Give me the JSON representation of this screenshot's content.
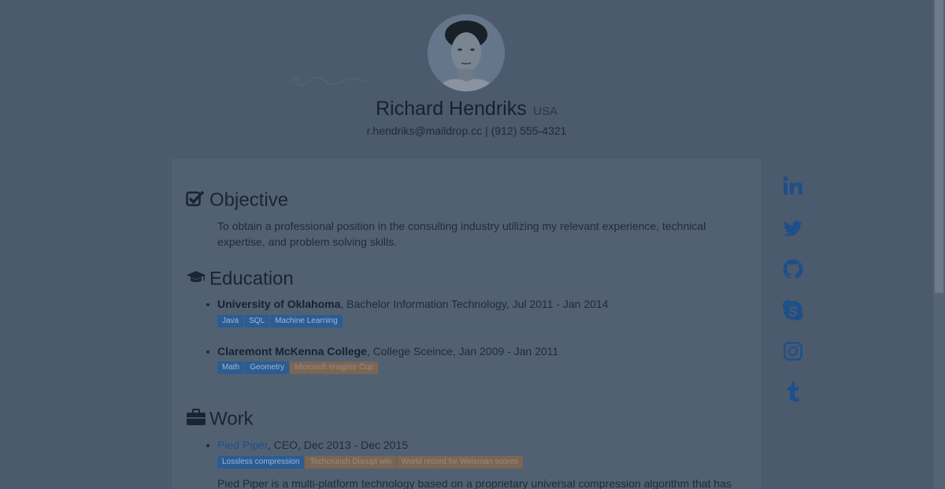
{
  "profile": {
    "name": "Richard Hendriks",
    "country": "USA",
    "email": "r.hendriks@maildrop.cc",
    "separator": " | ",
    "phone": "(912) 555-4321"
  },
  "sections": {
    "objective": {
      "title": "Objective",
      "text": "To obtain a professional position in the consulting industry utilizing my relevant experience, technical expertise, and problem solving skills."
    },
    "education": {
      "title": "Education",
      "items": [
        {
          "org": "University of Oklahoma",
          "details": ", Bachelor Information Technology, Jul 2011 - Jan 2014",
          "tags": [
            {
              "label": "Java",
              "color": "blue"
            },
            {
              "label": "SQL",
              "color": "blue"
            },
            {
              "label": "Machine Learning",
              "color": "blue"
            }
          ]
        },
        {
          "org": "Claremont McKenna College",
          "details": ", College Sceince, Jan 2009 - Jan 2011",
          "tags": [
            {
              "label": "Math",
              "color": "blue"
            },
            {
              "label": "Geometry",
              "color": "blue"
            },
            {
              "label": "Microsoft Imagine Cup",
              "color": "orange"
            }
          ]
        }
      ]
    },
    "work": {
      "title": "Work",
      "items": [
        {
          "org": "Pied Piper",
          "details": ", CEO, Dec 2013 - Dec 2015",
          "tags": [
            {
              "label": "Lossless compression",
              "color": "blue"
            },
            {
              "label": "Techcrunch Disrupt win",
              "color": "orange"
            },
            {
              "label": "World record for Weisman scores",
              "color": "orange"
            }
          ],
          "description": "Pied Piper is a multi-platform technology based on a proprietary universal compression algorithm that has"
        }
      ]
    }
  },
  "social": [
    {
      "name": "linkedin-icon"
    },
    {
      "name": "twitter-icon"
    },
    {
      "name": "github-icon"
    },
    {
      "name": "skype-icon"
    },
    {
      "name": "instagram-icon"
    },
    {
      "name": "tumblr-icon"
    }
  ],
  "colors": {
    "overlay_background": "#4b5a6c",
    "card_background": "#526172",
    "link_blue": "#1f4f8a",
    "tag_blue": "#2b5c93",
    "tag_orange": "#7a6655"
  }
}
